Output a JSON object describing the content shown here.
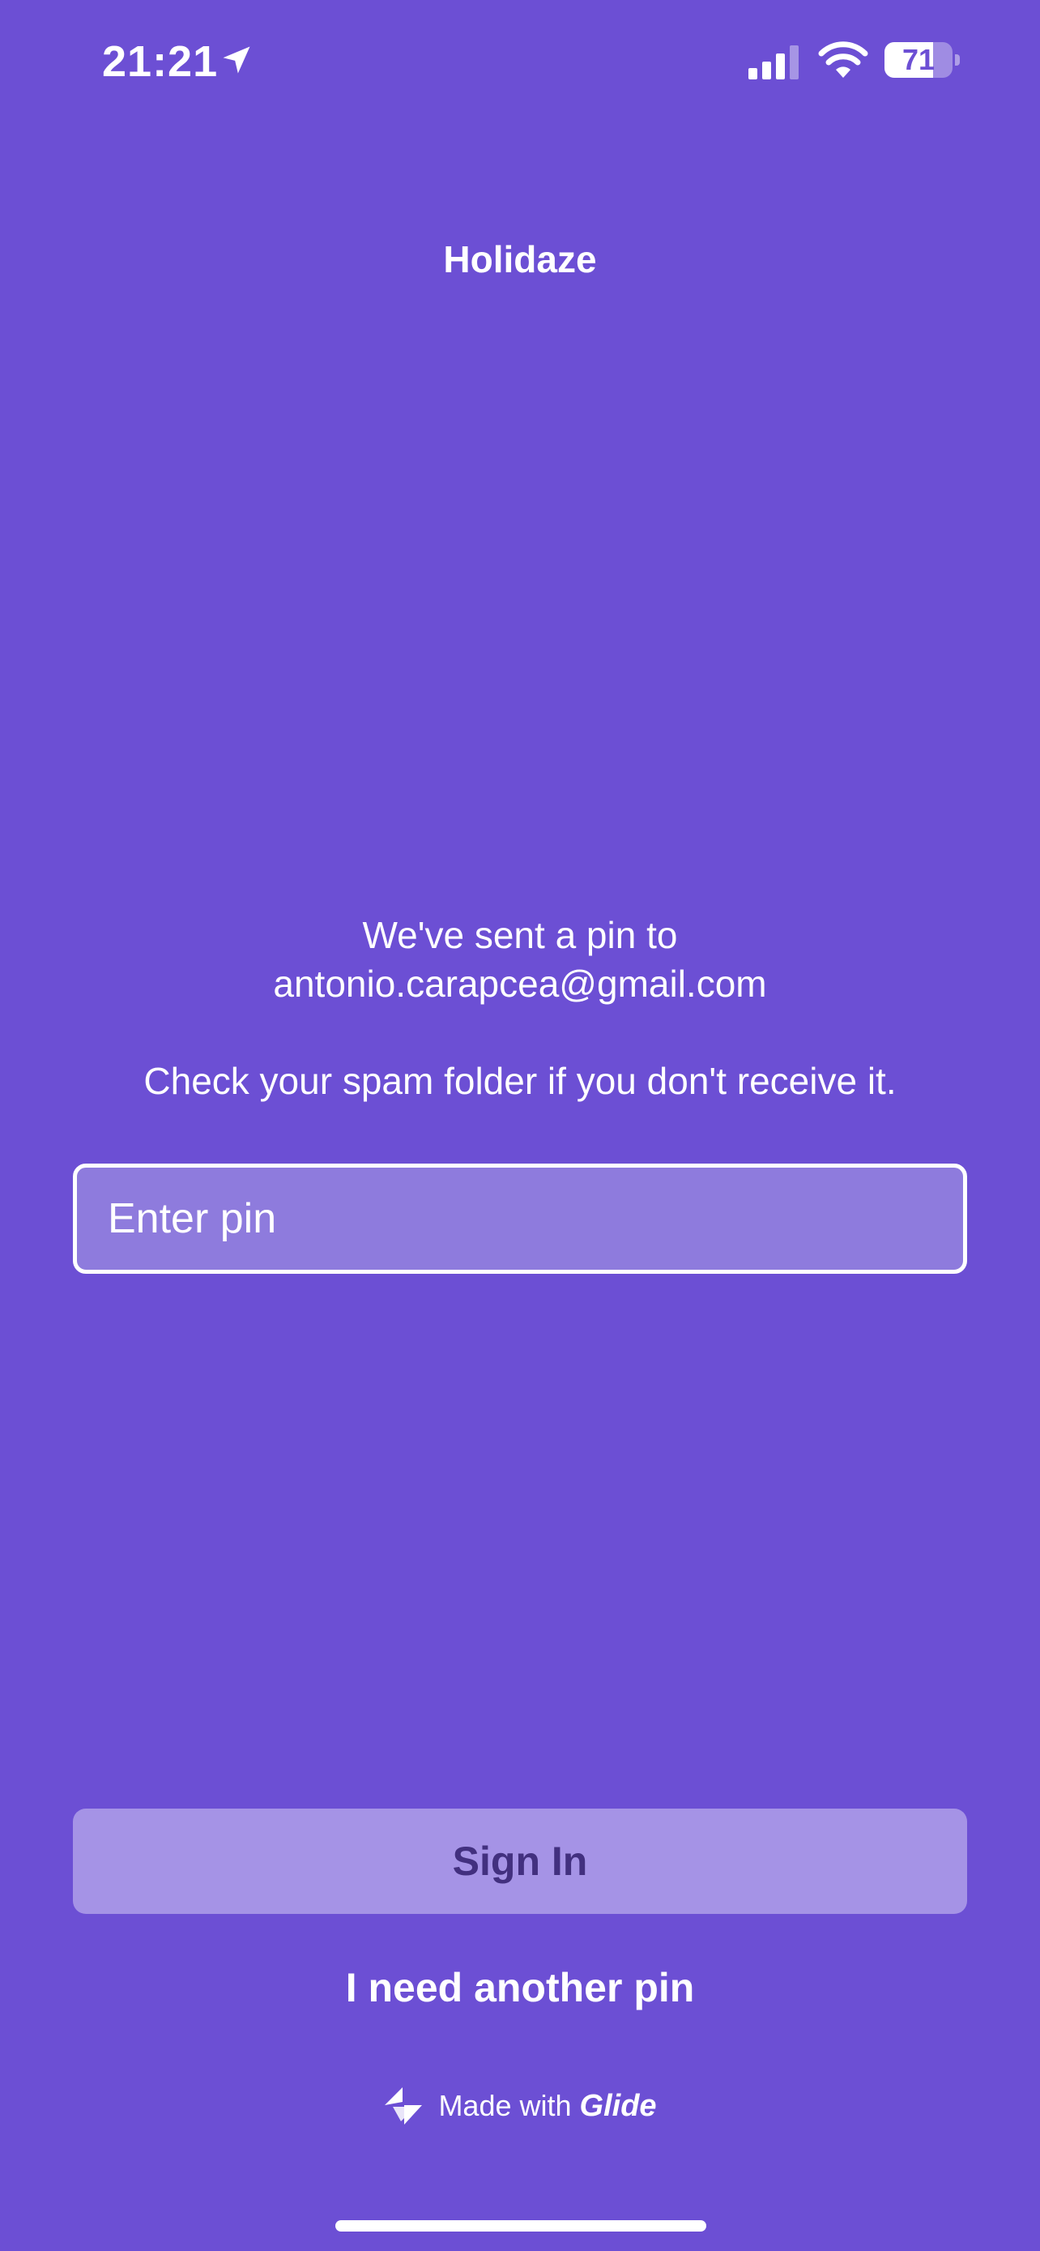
{
  "status_bar": {
    "time": "21:21",
    "battery_level": "71",
    "battery_fraction": 0.71
  },
  "app": {
    "title": "Holidaze"
  },
  "message": {
    "sent_line": "We've sent a pin to",
    "email": "antonio.carapcea@gmail.com",
    "spam_hint": "Check your spam folder if you don't receive it."
  },
  "pin_field": {
    "value": "",
    "placeholder": "Enter pin"
  },
  "actions": {
    "sign_in_label": "Sign In",
    "another_pin_label": "I need another pin"
  },
  "footer": {
    "made_with": "Made with",
    "brand": "Glide"
  },
  "colors": {
    "background": "#6c4fd4",
    "input_fill": "#8e7bdd",
    "button_fill": "#a593e6",
    "button_text": "#42307f"
  },
  "icons": [
    "location-arrow-icon",
    "cellular-signal-icon",
    "wifi-icon",
    "battery-icon",
    "glide-logo-icon"
  ]
}
